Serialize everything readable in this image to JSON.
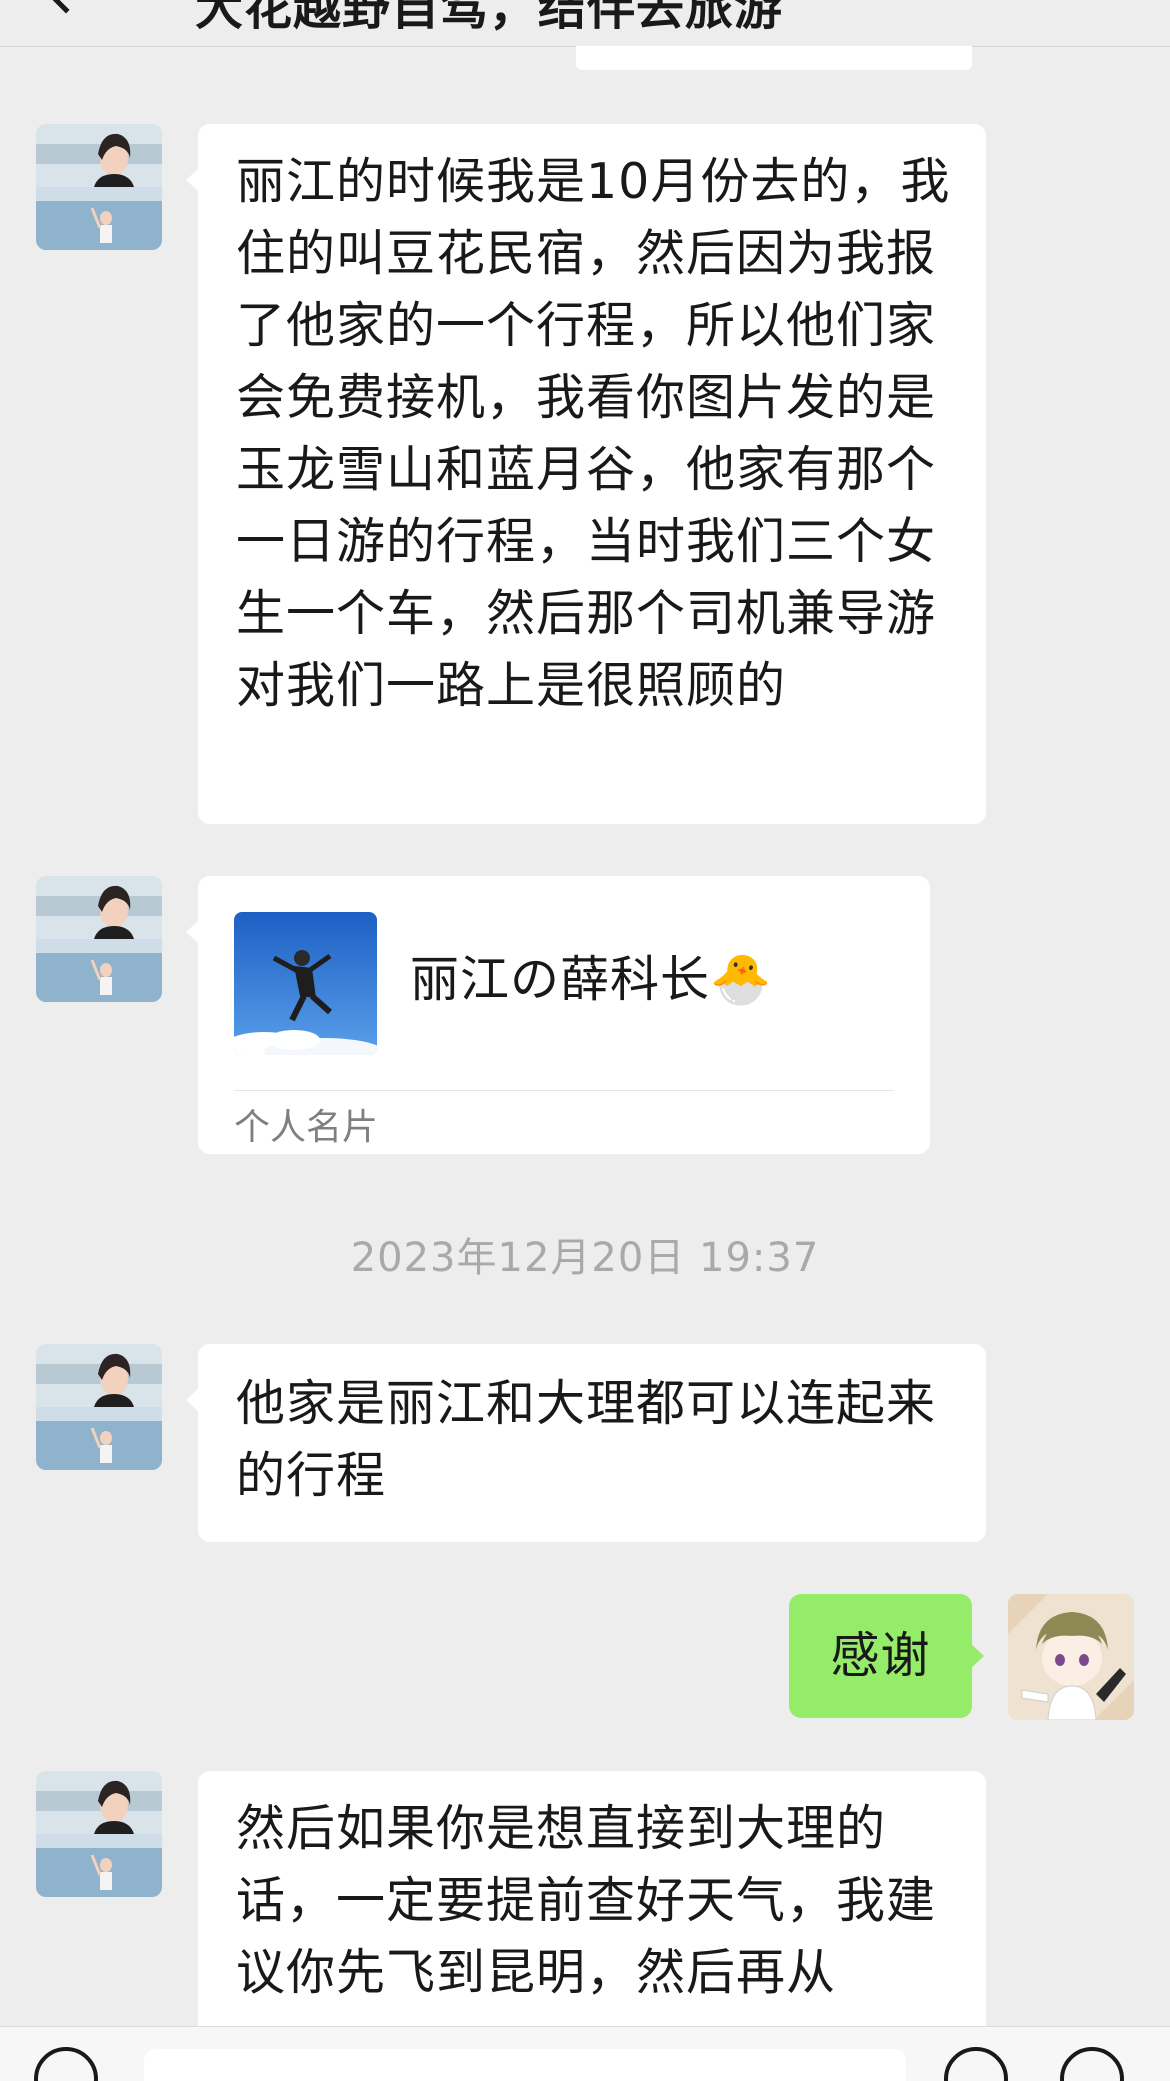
{
  "header": {
    "title": "大花越野自驾，结伴去旅游",
    "back_icon": "chevron-left-icon"
  },
  "messages": [
    {
      "side": "left",
      "type": "text",
      "text": "丽江的时候我是10月份去的，我住的叫豆花民宿，然后因为我报了他家的一个行程，所以他们家会免费接机，我看你图片发的是玉龙雪山和蓝月谷，他家有那个一日游的行程，当时我们三个女生一个车，然后那个司机兼导游对我们一路上是很照顾的"
    },
    {
      "side": "left",
      "type": "contact_card",
      "name": "丽江の薛科长🐣",
      "card_type": "个人名片"
    },
    {
      "side": "left",
      "type": "text",
      "text": "他家是丽江和大理都可以连起来的行程"
    },
    {
      "side": "right",
      "type": "text",
      "text": "感谢"
    },
    {
      "side": "left",
      "type": "text",
      "text": "然后如果你是想直接到大理的话，一定要提前查好天气，我建议你先飞到昆明，然后再从"
    }
  ],
  "timestamp": "2023年12月20日 19:37",
  "input_bar": {
    "voice_icon": "voice-icon",
    "emoji_icon": "emoji-icon",
    "plus_icon": "plus-icon",
    "input_value": ""
  },
  "colors": {
    "background": "#ededed",
    "incoming_bubble": "#ffffff",
    "outgoing_bubble": "#95ec69",
    "timestamp_text": "#a9a9a9"
  }
}
